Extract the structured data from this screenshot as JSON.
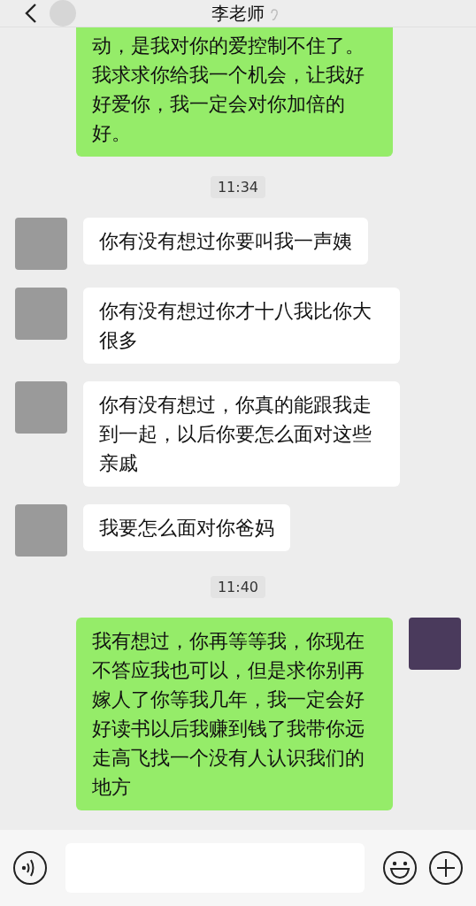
{
  "header": {
    "title": "李老师"
  },
  "messages": [
    {
      "kind": "sent",
      "avatar": false,
      "text": "动，是我对你的爱控制不住了。我求求你给我一个机会，让我好好爱你，我一定会对你加倍的好。"
    },
    {
      "kind": "time",
      "text": "11:34"
    },
    {
      "kind": "received",
      "text": "你有没有想过你要叫我一声姨"
    },
    {
      "kind": "received",
      "text": "你有没有想过你才十八我比你大很多"
    },
    {
      "kind": "received",
      "text": "你有没有想过，你真的能跟我走到一起，以后你要怎么面对这些亲戚"
    },
    {
      "kind": "received",
      "text": "我要怎么面对你爸妈"
    },
    {
      "kind": "time",
      "text": "11:40"
    },
    {
      "kind": "sent",
      "text": "我有想过，你再等等我，你现在不答应我也可以，但是求你别再嫁人了你等我几年，我一定会好好读书以后我赚到钱了我带你远走高飞找一个没有人认识我们的地方",
      "avatar": true
    }
  ]
}
